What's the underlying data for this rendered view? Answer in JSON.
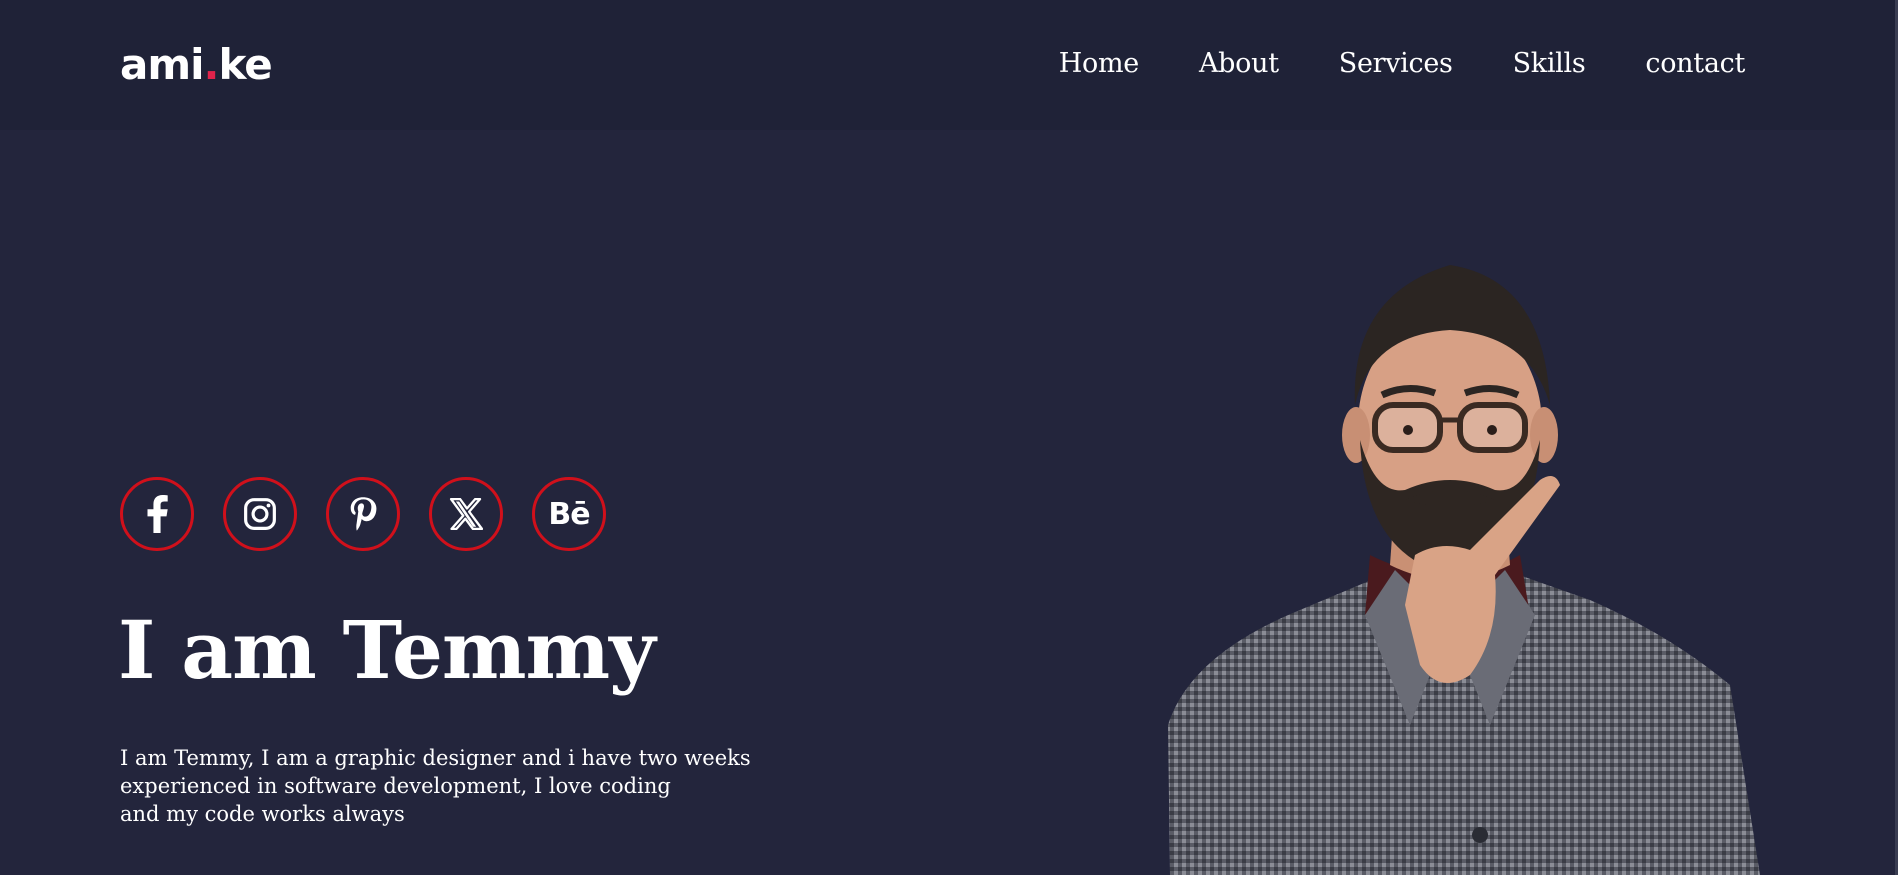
{
  "brand": {
    "logo_left": "ami",
    "logo_dot": ".",
    "logo_right": "ke"
  },
  "nav": {
    "items": [
      {
        "label": "Home"
      },
      {
        "label": "About"
      },
      {
        "label": "Services"
      },
      {
        "label": "Skills"
      },
      {
        "label": "contact"
      }
    ]
  },
  "socials": [
    {
      "name": "facebook-icon"
    },
    {
      "name": "instagram-icon"
    },
    {
      "name": "pinterest-icon"
    },
    {
      "name": "x-icon"
    },
    {
      "name": "behance-icon",
      "label": "Bē"
    }
  ],
  "hero": {
    "title": "I am Temmy",
    "description": "I am Temmy, I am a graphic designer and i have two weeks\nexperienced in software development, I love coding\nand my code works always"
  },
  "colors": {
    "background": "#23253c",
    "header": "#1f2237",
    "accent_ring": "#d0101b",
    "logo_dot": "#e0234b",
    "text": "#ffffff"
  }
}
